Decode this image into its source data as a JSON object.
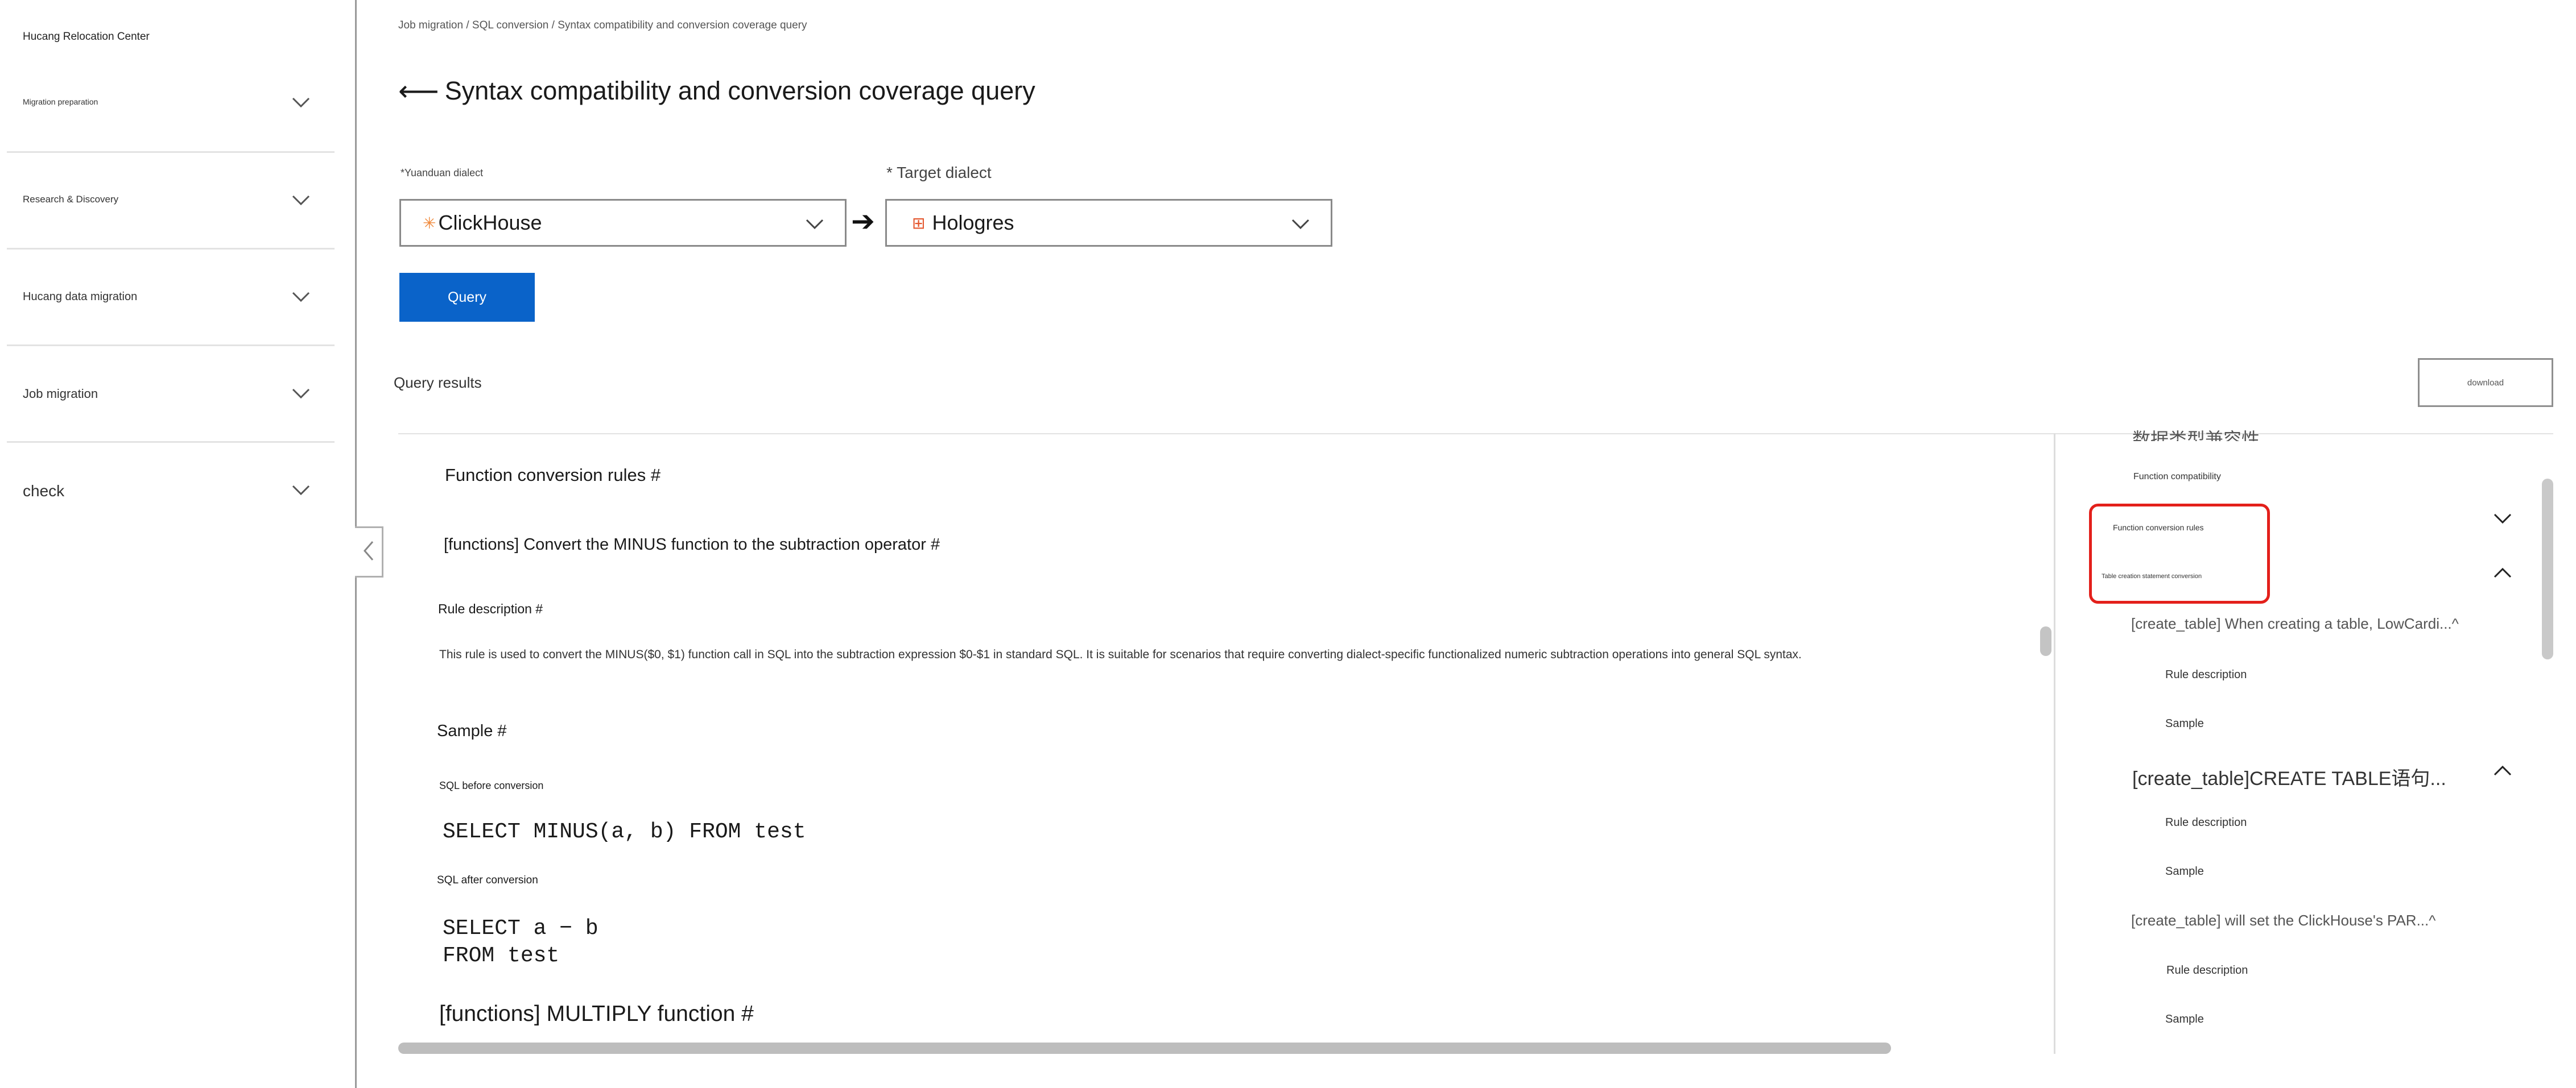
{
  "sidebar": {
    "title": "Hucang Relocation Center",
    "items": [
      {
        "label": "Migration preparation"
      },
      {
        "label": "Research & Discovery"
      },
      {
        "label": "Hucang data migration"
      },
      {
        "label": "Job migration"
      },
      {
        "label": "check"
      }
    ]
  },
  "breadcrumb": "Job migration / SQL conversion / Syntax compatibility and conversion coverage query",
  "page": {
    "back_arrow": "⟵",
    "title": "Syntax compatibility and conversion coverage query"
  },
  "form": {
    "source_label": "*Yuanduan dialect",
    "source_value": "ClickHouse",
    "source_icon": "✳",
    "arrow": "➔",
    "target_label": "* Target dialect",
    "target_value": "Hologres",
    "target_icon": "⊞",
    "query_label": "Query"
  },
  "results": {
    "label": "Query results",
    "download_label": "download"
  },
  "content": {
    "section_title": "Function conversion rules #",
    "rule1_title": "[functions] Convert the MINUS function to the subtraction operator #",
    "rule_desc_heading": "Rule description #",
    "rule_desc": "This rule is used to convert the MINUS($0, $1) function call in SQL into the subtraction expression $0-$1 in standard SQL. It is suitable for scenarios that require converting dialect-specific functionalized numeric subtraction operations into general SQL syntax.",
    "sample_heading": "Sample #",
    "before_label": "SQL before conversion",
    "before_code": "SELECT MINUS(a, b) FROM test",
    "after_label": "SQL after conversion",
    "after_code_1": "SELECT a − b",
    "after_code_2": "FROM test",
    "rule2_title": "[functions] MULTIPLY function #"
  },
  "toc": {
    "partial_top": "数据类型兼容性",
    "function_compatibility": "Function compatibility",
    "function_conversion_rules": "Function conversion rules",
    "table_creation": "Table creation statement conversion",
    "create1": "[create_table] When creating a table, LowCardi...^",
    "create1_desc": "Rule description",
    "create1_sample": "Sample",
    "create2": "[create_table]CREATE TABLE语句...",
    "create2_desc": "Rule description",
    "create2_sample": "Sample",
    "create3": "[create_table] will set the ClickHouse's PAR...^",
    "create3_desc": "Rule description",
    "create3_sample": "Sample"
  },
  "colors": {
    "primary": "#0a63c9",
    "highlight": "#e3201b"
  }
}
